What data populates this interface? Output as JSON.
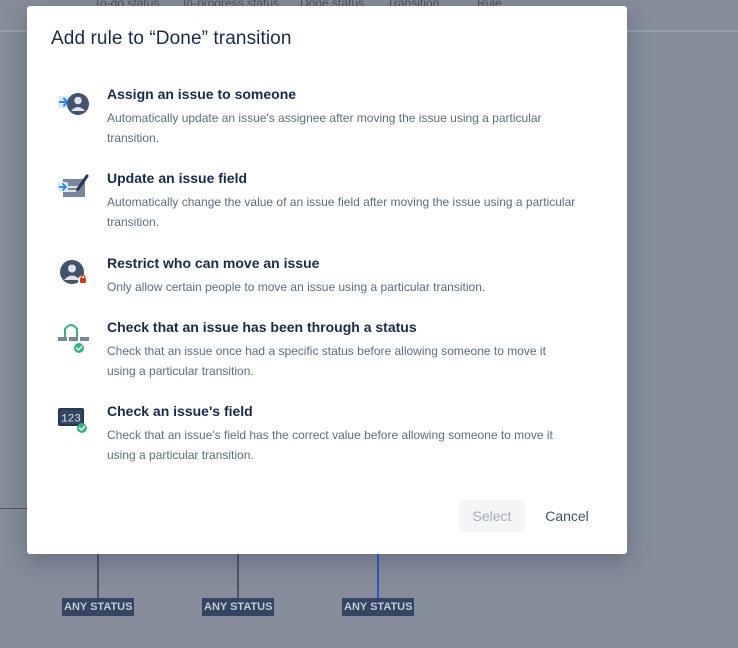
{
  "background": {
    "columns": [
      "To-do status",
      "In-progress status",
      "Done status",
      "Transition",
      "Rule"
    ],
    "any_status_labels": [
      "ANY STATUS",
      "ANY STATUS",
      "ANY STATUS"
    ]
  },
  "modal": {
    "title": "Add rule to “Done” transition",
    "rules": [
      {
        "icon": "assign-user-icon",
        "title": "Assign an issue to someone",
        "description": "Automatically update an issue's assignee after moving the issue using a particular transition."
      },
      {
        "icon": "edit-field-icon",
        "title": "Update an issue field",
        "description": "Automatically change the value of an issue field after moving the issue using a particular transition."
      },
      {
        "icon": "restricted-user-icon",
        "title": "Restrict who can move an issue",
        "description": "Only allow certain people to move an issue using a particular transition."
      },
      {
        "icon": "status-check-icon",
        "title": "Check that an issue has been through a status",
        "description": "Check that an issue once had a specific status before allowing someone to move it using a particular transition."
      },
      {
        "icon": "field-check-icon",
        "title": "Check an issue's field",
        "description": "Check that an issue's field has the correct value before allowing someone to move it using a particular transition."
      }
    ],
    "select_label": "Select",
    "cancel_label": "Cancel"
  },
  "colors": {
    "backdrop": "#868c99",
    "title_text": "#172b4d",
    "subtle_text": "#5e6c84",
    "accent_blue": "#2684ff",
    "success_green": "#36b37e",
    "danger_red": "#de350b"
  }
}
